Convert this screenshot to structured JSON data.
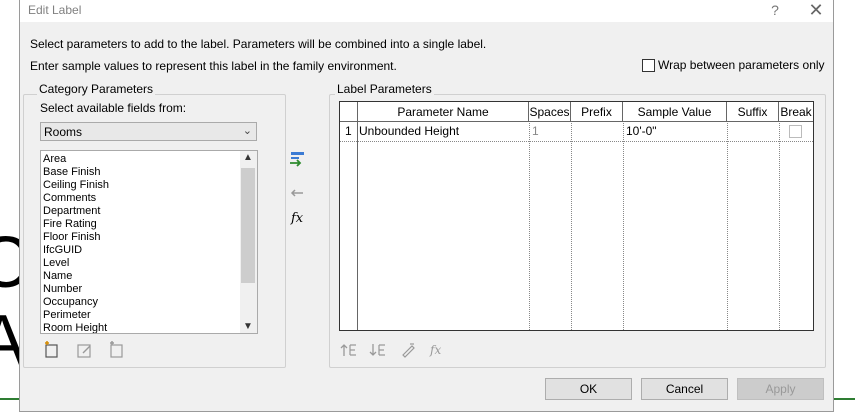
{
  "dialog": {
    "title": "Edit Label",
    "help_label": "?",
    "close_label": "✕"
  },
  "instructions": {
    "line1": "Select parameters to add to the label.  Parameters will be combined into a single label.",
    "line2": "Enter sample values to represent this label in the family environment."
  },
  "wrap_option": {
    "label": "Wrap between parameters only",
    "checked": false
  },
  "category": {
    "group_label": "Category Parameters",
    "select_label": "Select available fields from:",
    "selected": "Rooms",
    "fields": [
      "Area",
      "Base Finish",
      "Ceiling Finish",
      "Comments",
      "Department",
      "Fire Rating",
      "Floor Finish",
      "IfcGUID",
      "Level",
      "Name",
      "Number",
      "Occupancy",
      "Perimeter",
      "Room Height"
    ]
  },
  "label_params": {
    "group_label": "Label Parameters",
    "columns": [
      "Parameter Name",
      "Spaces",
      "Prefix",
      "Sample Value",
      "Suffix",
      "Break"
    ],
    "rows": [
      {
        "index": "1",
        "parameter_name": "Unbounded Height",
        "spaces": "1",
        "prefix": "",
        "sample_value": "10'-0\"",
        "suffix": "",
        "break": false
      }
    ]
  },
  "buttons": {
    "ok": "OK",
    "cancel": "Cancel",
    "apply": "Apply"
  },
  "icons": {
    "add_param": "add-parameter-icon",
    "remove_param": "remove-parameter-icon",
    "formula": "fx",
    "formula_small": "fx"
  }
}
